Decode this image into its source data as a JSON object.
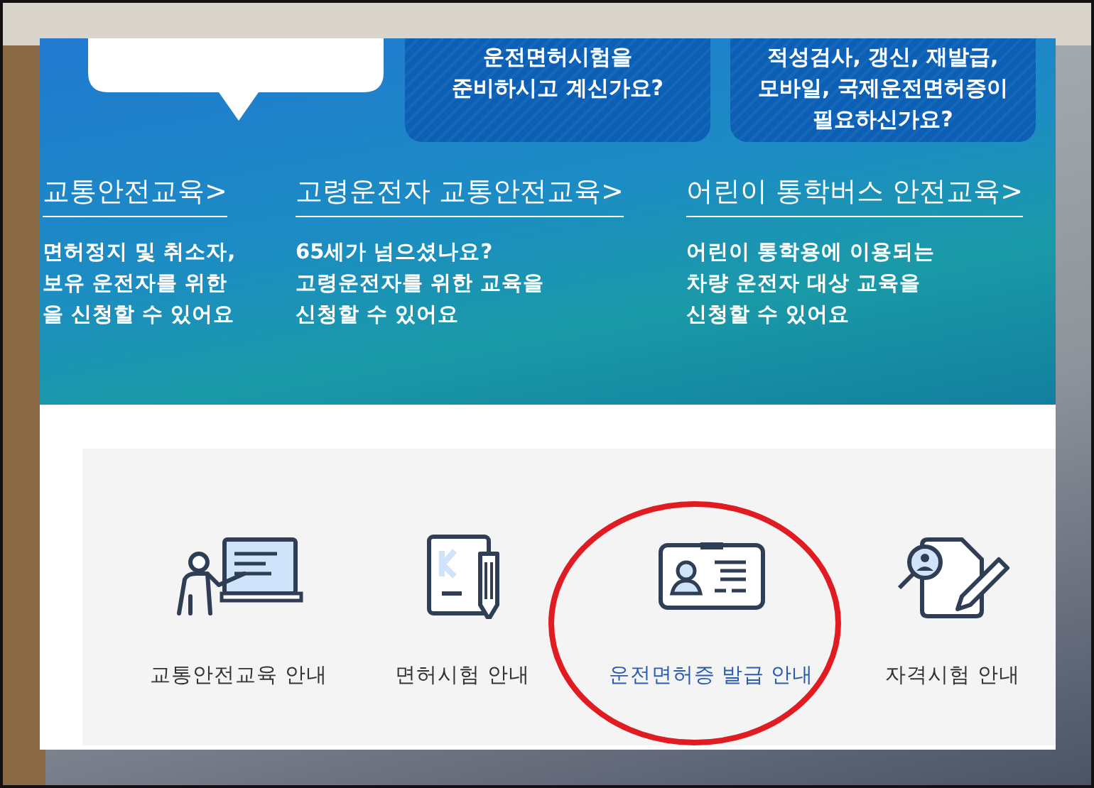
{
  "question_cards": [
    {
      "lines": [
        "운전면허시험을",
        "준비하시고 계신가요?"
      ]
    },
    {
      "lines": [
        "적성검사, 갱신, 재발급,",
        "모바일, 국제운전면허증이",
        "필요하신가요?"
      ]
    }
  ],
  "education_links": [
    {
      "title": "교통안전교육",
      "arrow": ">",
      "description": [
        "면허정지 및 취소자,",
        "보유 운전자를 위한",
        "을 신청할 수 있어요"
      ]
    },
    {
      "title": "고령운전자 교통안전교육",
      "arrow": ">",
      "description": [
        "65세가 넘으셨나요?",
        "고령운전자를 위한 교육을",
        "신청할 수 있어요"
      ]
    },
    {
      "title": "어린이 통학버스 안전교육",
      "arrow": ">",
      "description": [
        "어린이 통학용에 이용되는",
        "차량 운전자 대상 교육을",
        "신청할 수 있어요"
      ]
    }
  ],
  "guide_menu": [
    {
      "kind": "lecture",
      "label": "교통안전교육 안내",
      "selected": false,
      "circled": false
    },
    {
      "kind": "exam",
      "label": "면허시험 안내",
      "selected": false,
      "circled": false
    },
    {
      "kind": "license",
      "label": "운전면허증 발급 안내",
      "selected": true,
      "circled": true
    },
    {
      "kind": "qualification",
      "label": "자격시험 안내",
      "selected": false,
      "circled": false
    }
  ]
}
